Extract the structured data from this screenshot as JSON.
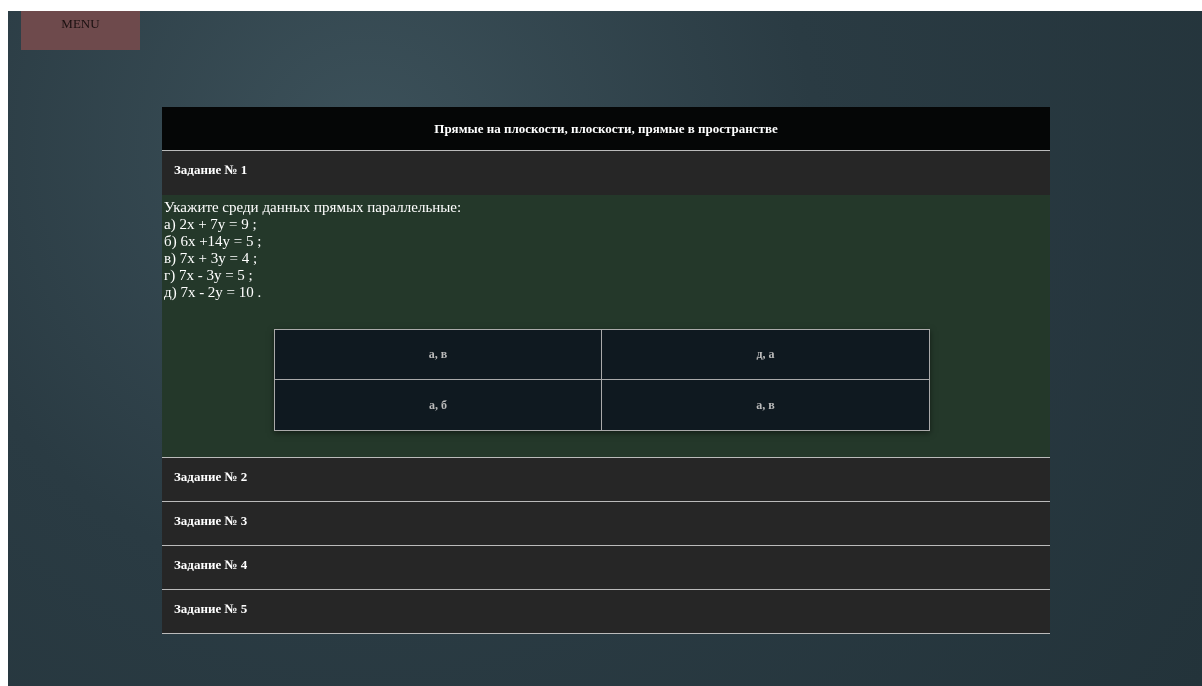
{
  "menu_button": "MENU",
  "panel_title": "Прямые на плоскости, плоскости, прямые в пространстве",
  "tasks": [
    {
      "title": "Задание № 1",
      "expanded": true,
      "question": [
        "Укажите среди данных прямых параллельные:",
        "а) 2x + 7y = 9 ;",
        "б) 6x +14y = 5 ;",
        "в) 7x + 3y = 4 ;",
        "г) 7x - 3y = 5 ;",
        "д) 7x - 2y = 10 ."
      ],
      "answers": [
        "а, в",
        "д, а",
        "а, б",
        "а, в"
      ]
    },
    {
      "title": "Задание № 2",
      "expanded": false
    },
    {
      "title": "Задание № 3",
      "expanded": false
    },
    {
      "title": "Задание № 4",
      "expanded": false
    },
    {
      "title": "Задание № 5",
      "expanded": false
    }
  ]
}
